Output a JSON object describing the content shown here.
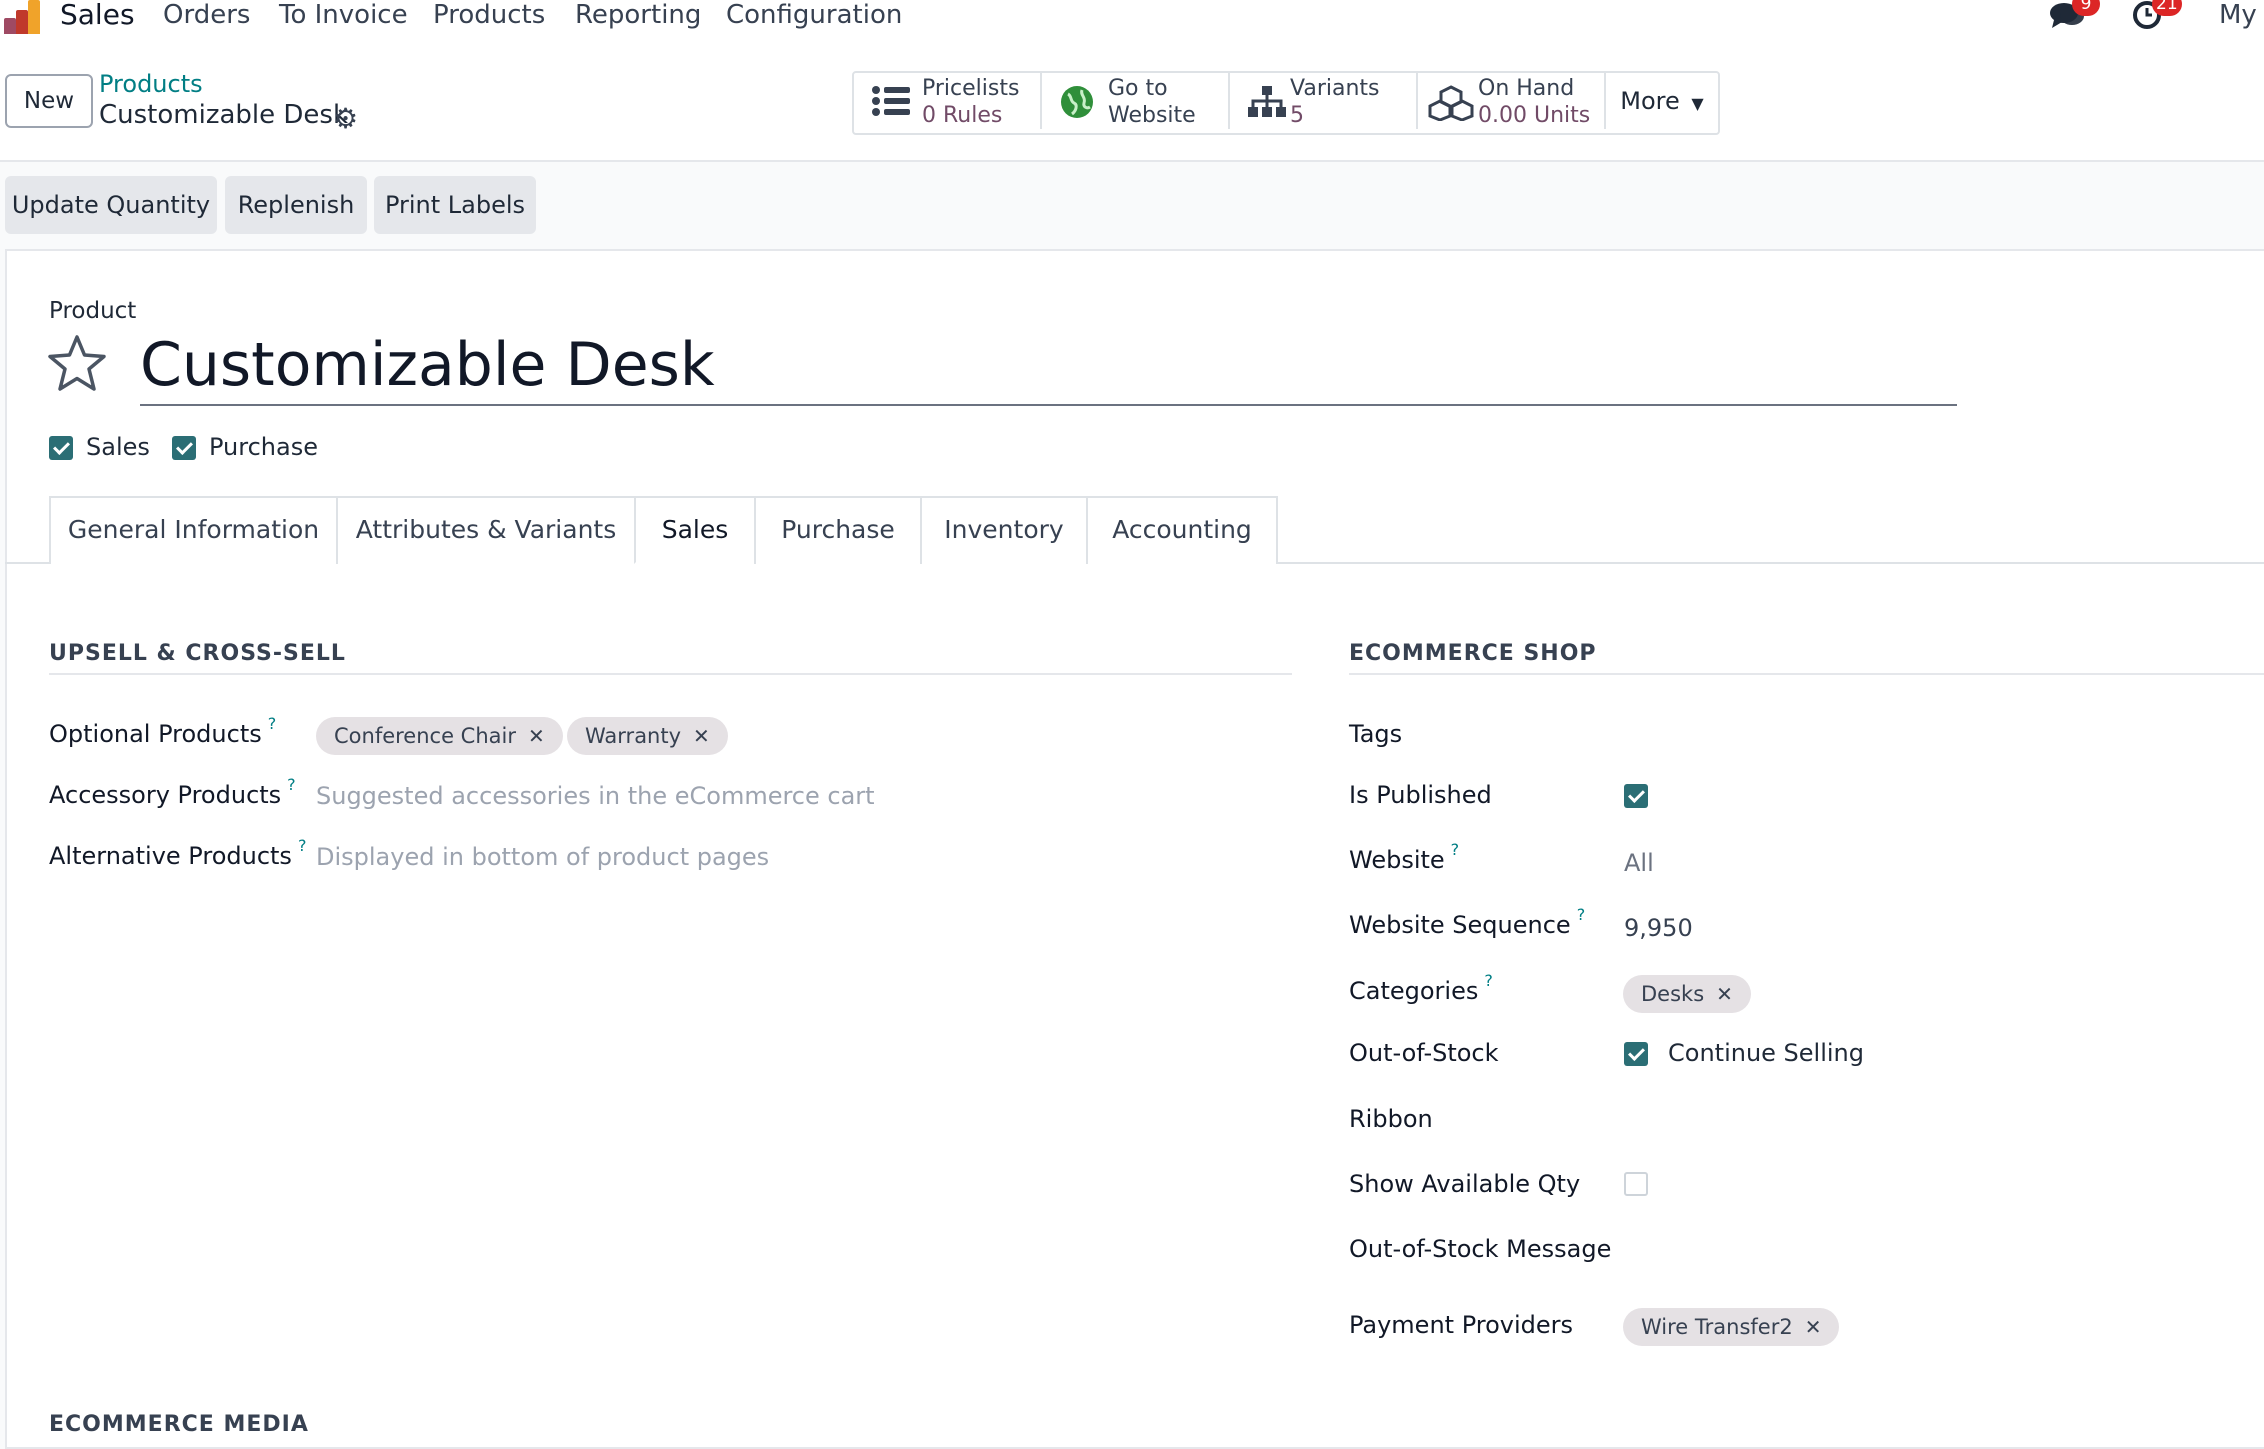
{
  "navbar": {
    "app": "Sales",
    "menu": [
      "Orders",
      "To Invoice",
      "Products",
      "Reporting",
      "Configuration"
    ],
    "messages_badge": "9",
    "activities_badge": "21",
    "user_label": "My"
  },
  "control": {
    "new_label": "New",
    "breadcrumb_parent": "Products",
    "breadcrumb_current": "Customizable Desk",
    "smart_buttons": {
      "pricelists_label": "Pricelists",
      "pricelists_value": "0  Rules",
      "website_label": "Go to",
      "website_value": "Website",
      "variants_label": "Variants",
      "variants_value": "5",
      "onhand_label": "On Hand",
      "onhand_value": "0.00 Units",
      "more_label": "More"
    }
  },
  "actions": [
    "Update Quantity",
    "Replenish",
    "Print Labels"
  ],
  "form": {
    "product_caption": "Product",
    "title": "Customizable Desk",
    "can_be_sold": "Sales",
    "can_be_purchased": "Purchase",
    "tabs": [
      "General Information",
      "Attributes & Variants",
      "Sales",
      "Purchase",
      "Inventory",
      "Accounting"
    ],
    "active_tab": "Sales"
  },
  "upsell": {
    "heading": "UPSELL & CROSS-SELL",
    "optional_label": "Optional Products",
    "optional_tags": [
      "Conference Chair",
      "Warranty"
    ],
    "accessory_label": "Accessory Products",
    "accessory_placeholder": "Suggested accessories in the eCommerce cart",
    "alternative_label": "Alternative Products",
    "alternative_placeholder": "Displayed in bottom of product pages"
  },
  "ecommerce": {
    "heading": "ECOMMERCE SHOP",
    "tags_label": "Tags",
    "published_label": "Is Published",
    "website_label": "Website",
    "website_value": "All",
    "sequence_label": "Website Sequence",
    "sequence_value": "9,950",
    "categories_label": "Categories",
    "category_tag": "Desks",
    "oos_label": "Out-of-Stock",
    "oos_value": "Continue Selling",
    "ribbon_label": "Ribbon",
    "qty_label": "Show Available Qty",
    "oos_msg_label": "Out-of-Stock Message",
    "payment_label": "Payment Providers",
    "payment_tag": "Wire Transfer2"
  },
  "media": {
    "heading": "ECOMMERCE MEDIA"
  },
  "help_mark": "?",
  "remove_mark": "✕",
  "colors": {
    "brand": "#714b67",
    "accent": "#017e84",
    "checkbox": "#2b6e75"
  }
}
